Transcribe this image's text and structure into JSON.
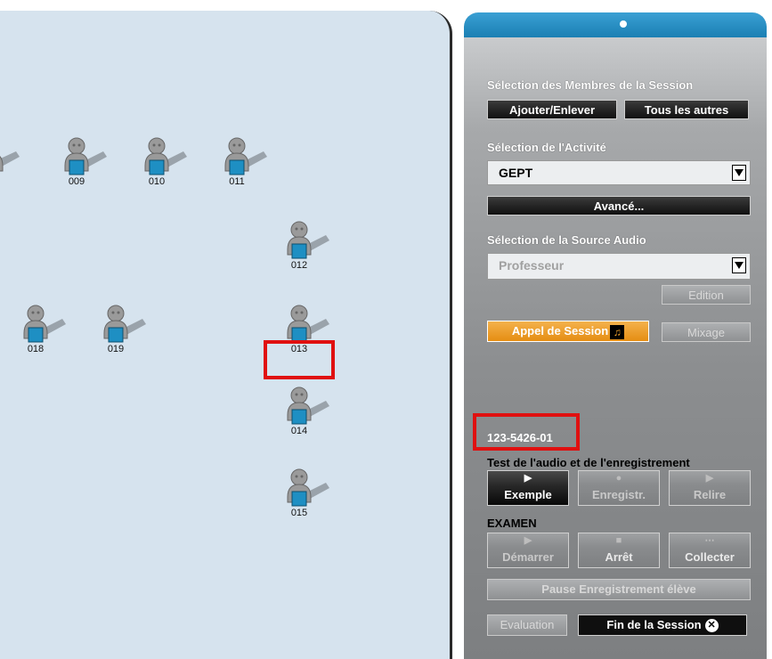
{
  "students": [
    {
      "label": "009"
    },
    {
      "label": "010"
    },
    {
      "label": "011"
    },
    {
      "label": "012"
    },
    {
      "label": "018"
    },
    {
      "label": "019"
    },
    {
      "label": "013"
    },
    {
      "label": "014"
    },
    {
      "label": "015"
    }
  ],
  "panel": {
    "members_title": "Sélection des Membres de la Session",
    "add_remove": "Ajouter/Enlever",
    "all_others": "Tous les autres",
    "activity_title": "Sélection de l'Activité",
    "activity_value": "GEPT",
    "advanced": "Avancé...",
    "audio_title": "Sélection de la Source Audio",
    "audio_value": "Professeur",
    "edit": "Edition",
    "session_call": "Appel de Session",
    "mix": "Mixage",
    "code": "123-5426-01",
    "test_title": "Test de l'audio et de l'enregistrement",
    "example": "Exemple",
    "record": "Enregistr.",
    "replay": "Relire",
    "exam_title": "EXAMEN",
    "start": "Démarrer",
    "stop": "Arrêt",
    "collect": "Collecter",
    "pause_recording": "Pause Enregistrement élève",
    "evaluation": "Evaluation",
    "end_session": "Fin de la Session"
  },
  "colors": {
    "room_bg": "#d6e3ee",
    "header_blue": "#1a7fb3",
    "accent_orange": "#e58d12",
    "highlight": "#e01010",
    "desk_blue": "#1e8fc3"
  }
}
